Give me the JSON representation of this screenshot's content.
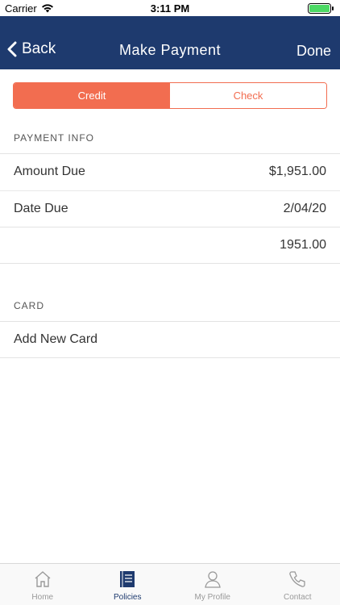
{
  "status": {
    "carrier": "Carrier",
    "time": "3:11 PM"
  },
  "nav": {
    "back_label": "Back",
    "title": "Make Payment",
    "done_label": "Done"
  },
  "segment": {
    "options": [
      "Credit",
      "Check"
    ],
    "selected": "Credit"
  },
  "payment_info": {
    "header": "PAYMENT INFO",
    "rows": [
      {
        "label": "Amount Due",
        "value": "$1,951.00"
      },
      {
        "label": "Date Due",
        "value": "2/04/20"
      },
      {
        "label": "",
        "value": "1951.00"
      }
    ]
  },
  "card": {
    "header": "CARD",
    "add_label": "Add New Card"
  },
  "tabbar": {
    "items": [
      {
        "label": "Home",
        "icon": "home-icon"
      },
      {
        "label": "Policies",
        "icon": "policies-icon"
      },
      {
        "label": "My Profile",
        "icon": "profile-icon"
      },
      {
        "label": "Contact",
        "icon": "phone-icon"
      }
    ],
    "active": "Policies"
  },
  "colors": {
    "nav": "#1e3a6e",
    "accent": "#f26d50"
  }
}
